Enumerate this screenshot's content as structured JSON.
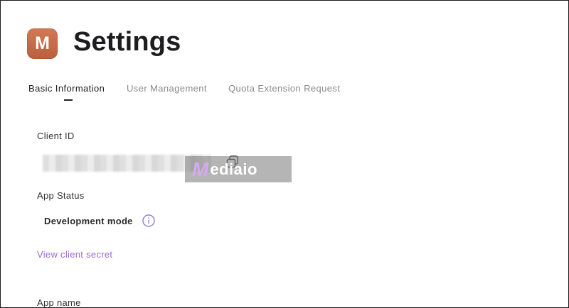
{
  "app": {
    "logo_letter": "M"
  },
  "header": {
    "title": "Settings"
  },
  "tabs": [
    {
      "label": "Basic Information",
      "active": true
    },
    {
      "label": "User Management",
      "active": false
    },
    {
      "label": "Quota Extension Request",
      "active": false
    }
  ],
  "basic_info": {
    "client_id_label": "Client ID",
    "app_status_label": "App Status",
    "app_status_value": "Development mode",
    "view_secret_link": "View client secret",
    "app_name_label": "App name"
  },
  "watermark": {
    "brand_initial": "M",
    "brand_rest": "ediaio"
  },
  "colors": {
    "logo": "#c96c47",
    "link": "#9b6bd1",
    "info_icon": "#8a7fd6"
  },
  "icons": {
    "copy": "copy-icon",
    "info": "info-icon"
  }
}
